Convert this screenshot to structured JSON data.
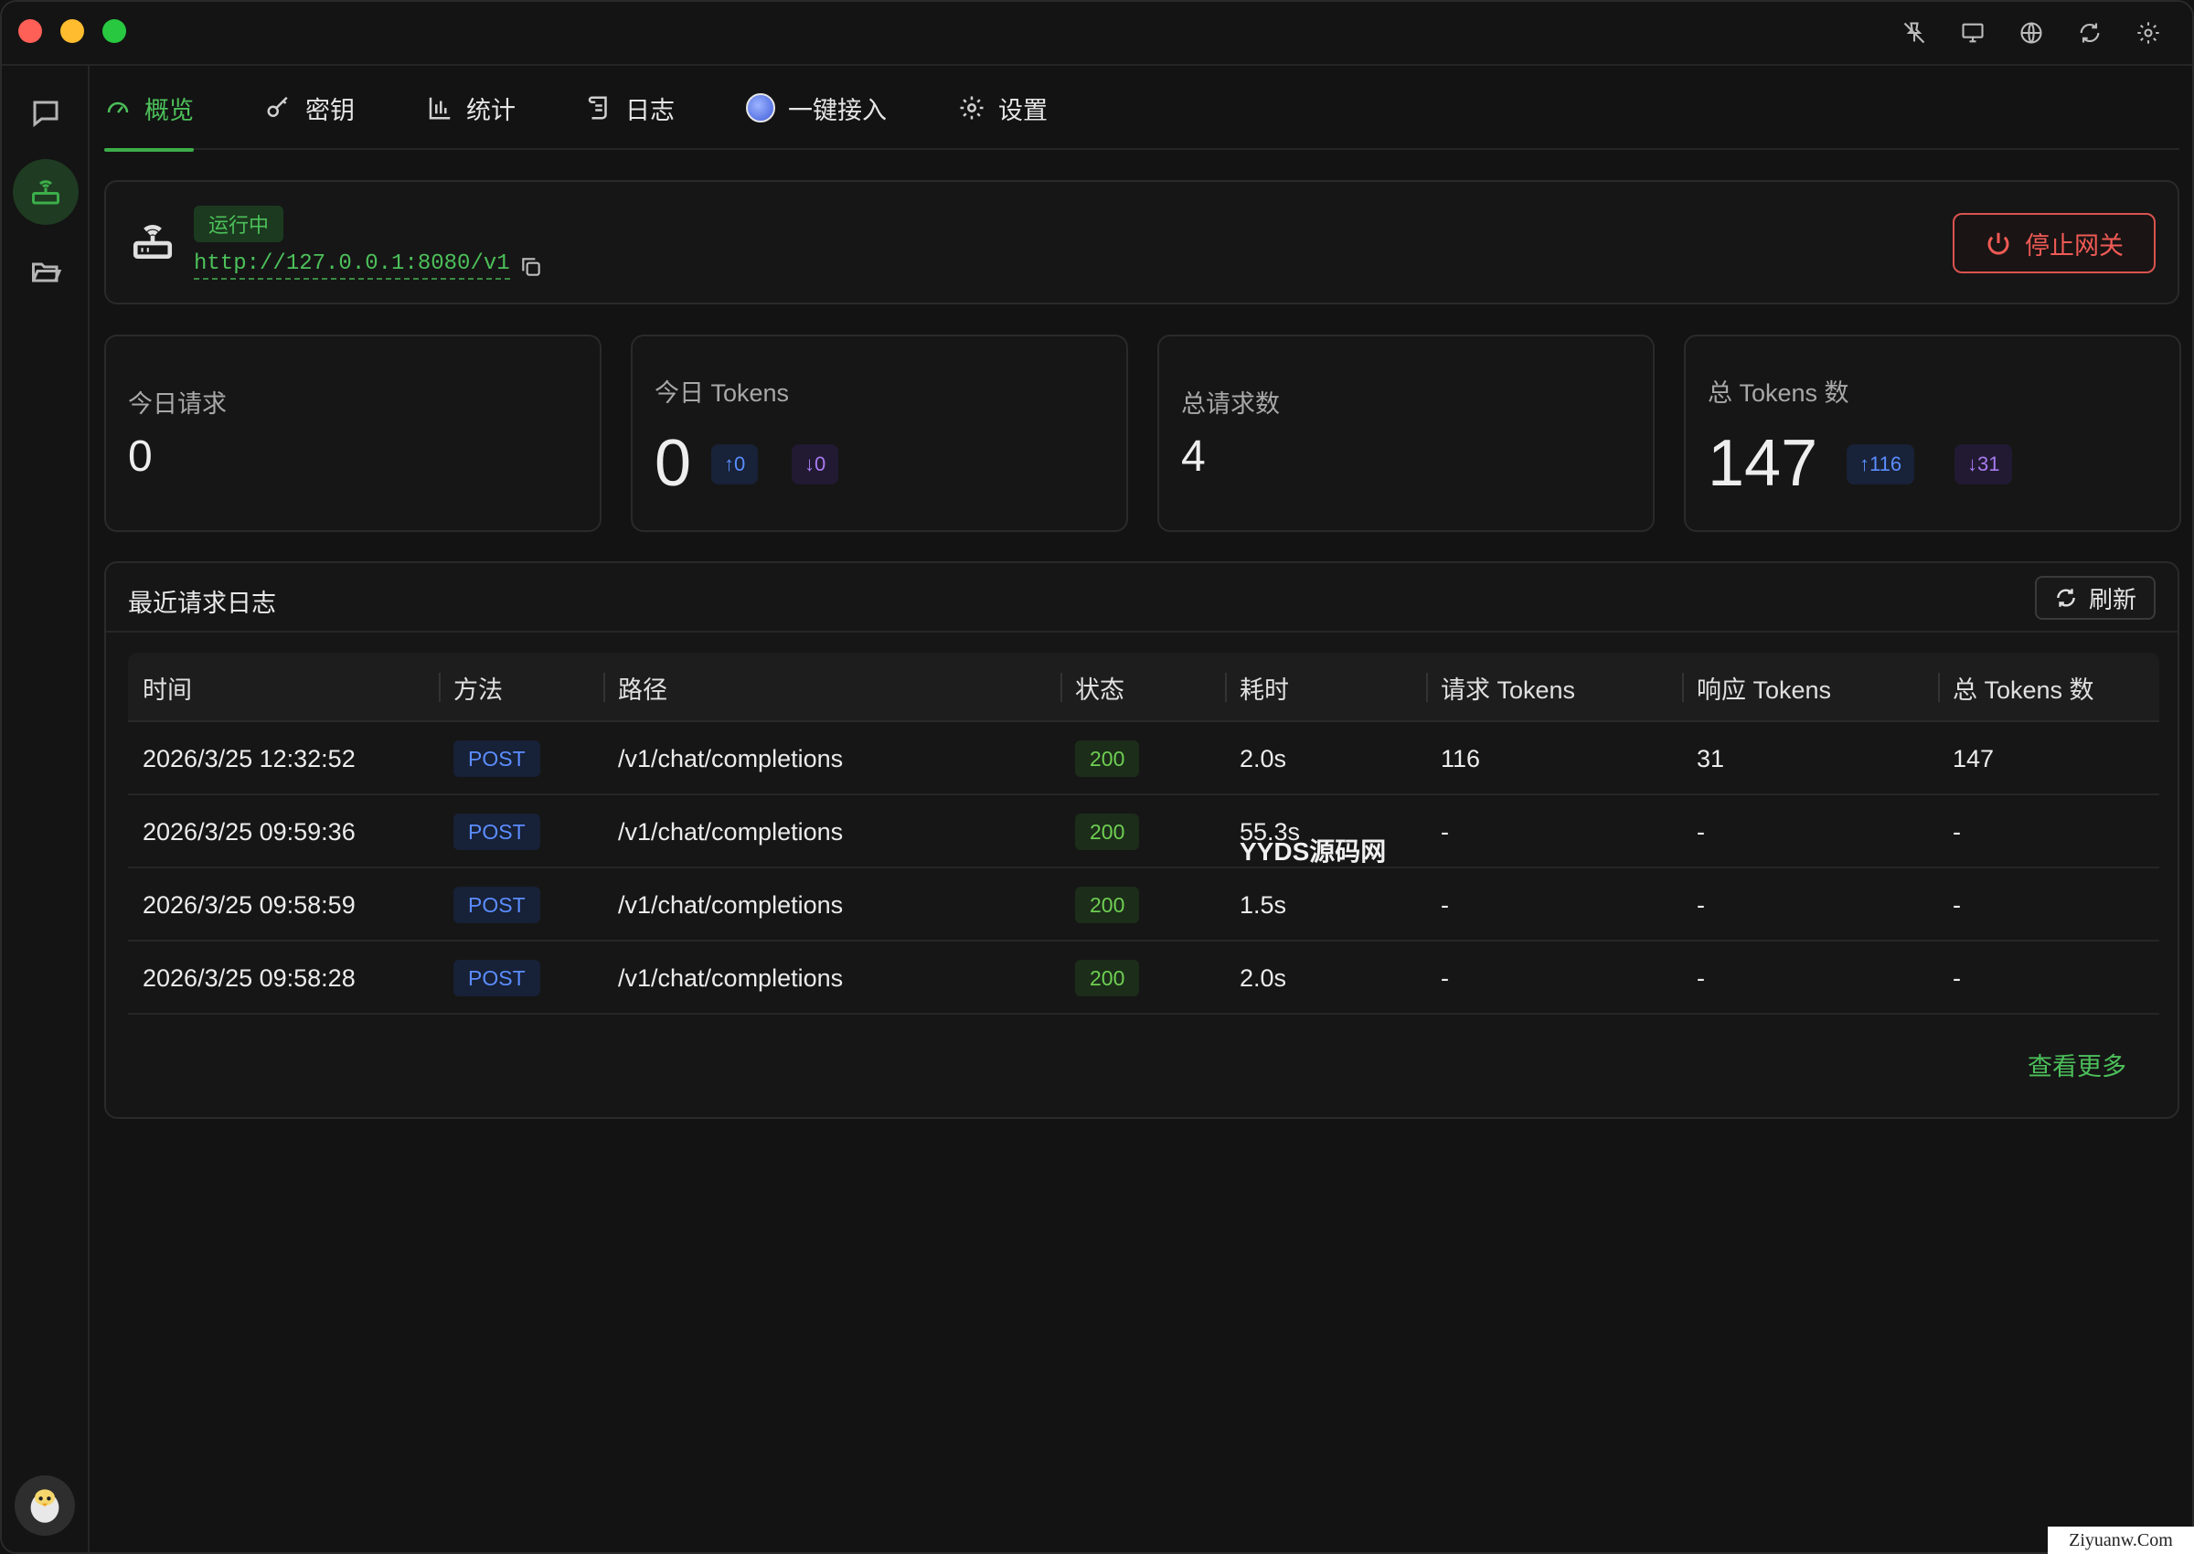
{
  "tabs": [
    {
      "label": "概览",
      "icon": "gauge-icon",
      "active": true
    },
    {
      "label": "密钥",
      "icon": "key-icon"
    },
    {
      "label": "统计",
      "icon": "bar-chart-icon"
    },
    {
      "label": "日志",
      "icon": "scroll-icon"
    },
    {
      "label": "一键接入",
      "icon": "connect-icon"
    },
    {
      "label": "设置",
      "icon": "gear-icon"
    }
  ],
  "gateway": {
    "status": "运行中",
    "url": "http://127.0.0.1:8080/v1",
    "stop_label": "停止网关"
  },
  "stats": {
    "today_requests": {
      "label": "今日请求",
      "value": "0"
    },
    "today_tokens": {
      "label": "今日 Tokens",
      "value": "0",
      "up": "↑0",
      "down": "↓0"
    },
    "total_requests": {
      "label": "总请求数",
      "value": "4"
    },
    "total_tokens": {
      "label": "总 Tokens 数",
      "value": "147",
      "up": "↑116",
      "down": "↓31"
    }
  },
  "logs": {
    "title": "最近请求日志",
    "refresh_label": "刷新",
    "more_label": "查看更多",
    "columns": [
      "时间",
      "方法",
      "路径",
      "状态",
      "耗时",
      "请求 Tokens",
      "响应 Tokens",
      "总 Tokens 数"
    ],
    "rows": [
      {
        "time": "2026/3/25 12:32:52",
        "method": "POST",
        "path": "/v1/chat/completions",
        "status": "200",
        "duration": "2.0s",
        "req": "116",
        "resp": "31",
        "total": "147"
      },
      {
        "time": "2026/3/25 09:59:36",
        "method": "POST",
        "path": "/v1/chat/completions",
        "status": "200",
        "duration": "55.3s",
        "req": "-",
        "resp": "-",
        "total": "-"
      },
      {
        "time": "2026/3/25 09:58:59",
        "method": "POST",
        "path": "/v1/chat/completions",
        "status": "200",
        "duration": "1.5s",
        "req": "-",
        "resp": "-",
        "total": "-"
      },
      {
        "time": "2026/3/25 09:58:28",
        "method": "POST",
        "path": "/v1/chat/completions",
        "status": "200",
        "duration": "2.0s",
        "req": "-",
        "resp": "-",
        "total": "-"
      }
    ]
  },
  "overlay": {
    "watermark": "YYDS源码网",
    "corner": "Ziyuanw.Com"
  },
  "colors": {
    "accent": "#4cc05a",
    "danger": "#ef5a55",
    "up": "#5b8dff",
    "down": "#a77bf0"
  }
}
